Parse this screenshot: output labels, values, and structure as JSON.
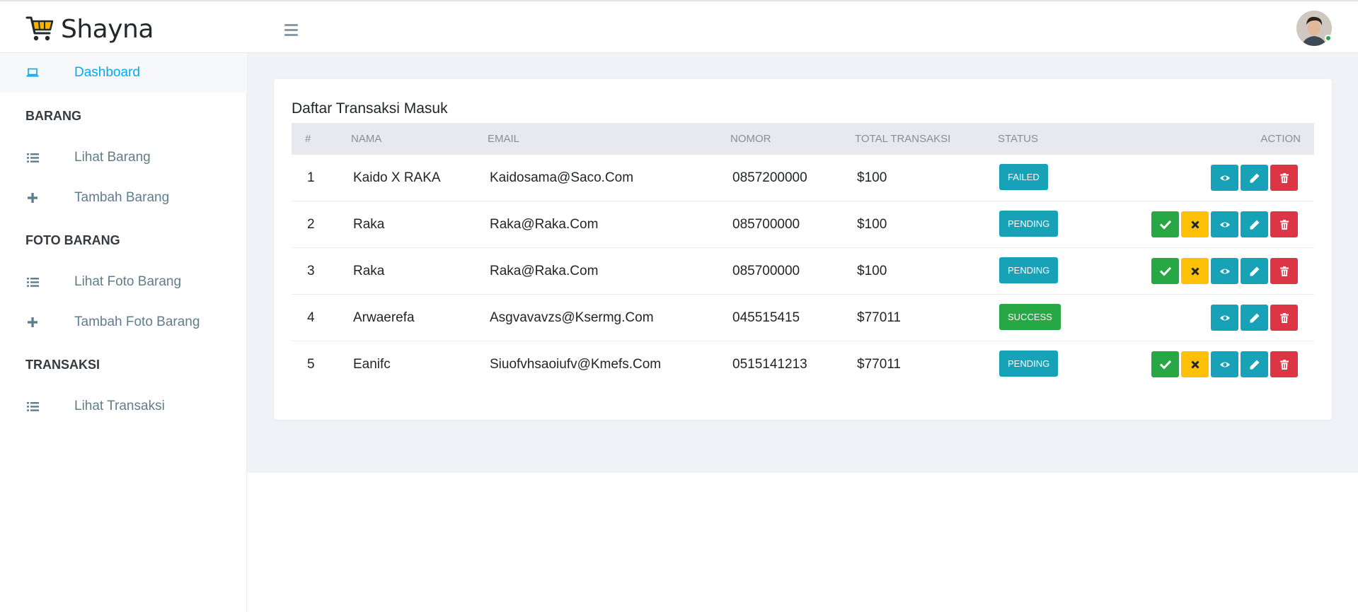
{
  "app": {
    "brand": "Shayna"
  },
  "sidebar": {
    "dashboard": {
      "label": "Dashboard",
      "icon": "laptop-icon"
    },
    "sections": [
      {
        "heading": "BARANG",
        "items": [
          {
            "label": "Lihat Barang",
            "icon": "list-icon"
          },
          {
            "label": "Tambah Barang",
            "icon": "plus-icon"
          }
        ]
      },
      {
        "heading": "FOTO BARANG",
        "items": [
          {
            "label": "Lihat Foto Barang",
            "icon": "list-icon"
          },
          {
            "label": "Tambah Foto Barang",
            "icon": "plus-icon"
          }
        ]
      },
      {
        "heading": "TRANSAKSI",
        "items": [
          {
            "label": "Lihat Transaksi",
            "icon": "list-icon"
          }
        ]
      }
    ]
  },
  "main": {
    "title": "Daftar Transaksi Masuk",
    "columns": [
      "#",
      "NAMA",
      "EMAIL",
      "NOMOR",
      "TOTAL TRANSAKSI",
      "STATUS",
      "ACTION"
    ],
    "rows": [
      {
        "no": "1",
        "nama": "Kaido X RAKA",
        "email": "Kaidosama@Saco.Com",
        "nomor": "0857200000",
        "total": "$100",
        "status": "FAILED"
      },
      {
        "no": "2",
        "nama": "Raka",
        "email": "Raka@Raka.Com",
        "nomor": "085700000",
        "total": "$100",
        "status": "PENDING"
      },
      {
        "no": "3",
        "nama": "Raka",
        "email": "Raka@Raka.Com",
        "nomor": "085700000",
        "total": "$100",
        "status": "PENDING"
      },
      {
        "no": "4",
        "nama": "Arwaerefa",
        "email": "Asgvavavzs@Ksermg.Com",
        "nomor": "045515415",
        "total": "$77011",
        "status": "SUCCESS"
      },
      {
        "no": "5",
        "nama": "Eanifc",
        "email": "Siuofvhsaoiufv@Kmefs.Com",
        "nomor": "0515141213",
        "total": "$77011",
        "status": "PENDING"
      }
    ]
  },
  "colors": {
    "accent": "#03a9f3",
    "info": "#17a2b8",
    "success": "#28a745",
    "warning": "#ffc107",
    "danger": "#dc3545",
    "content_bg": "#f1f2f7"
  }
}
